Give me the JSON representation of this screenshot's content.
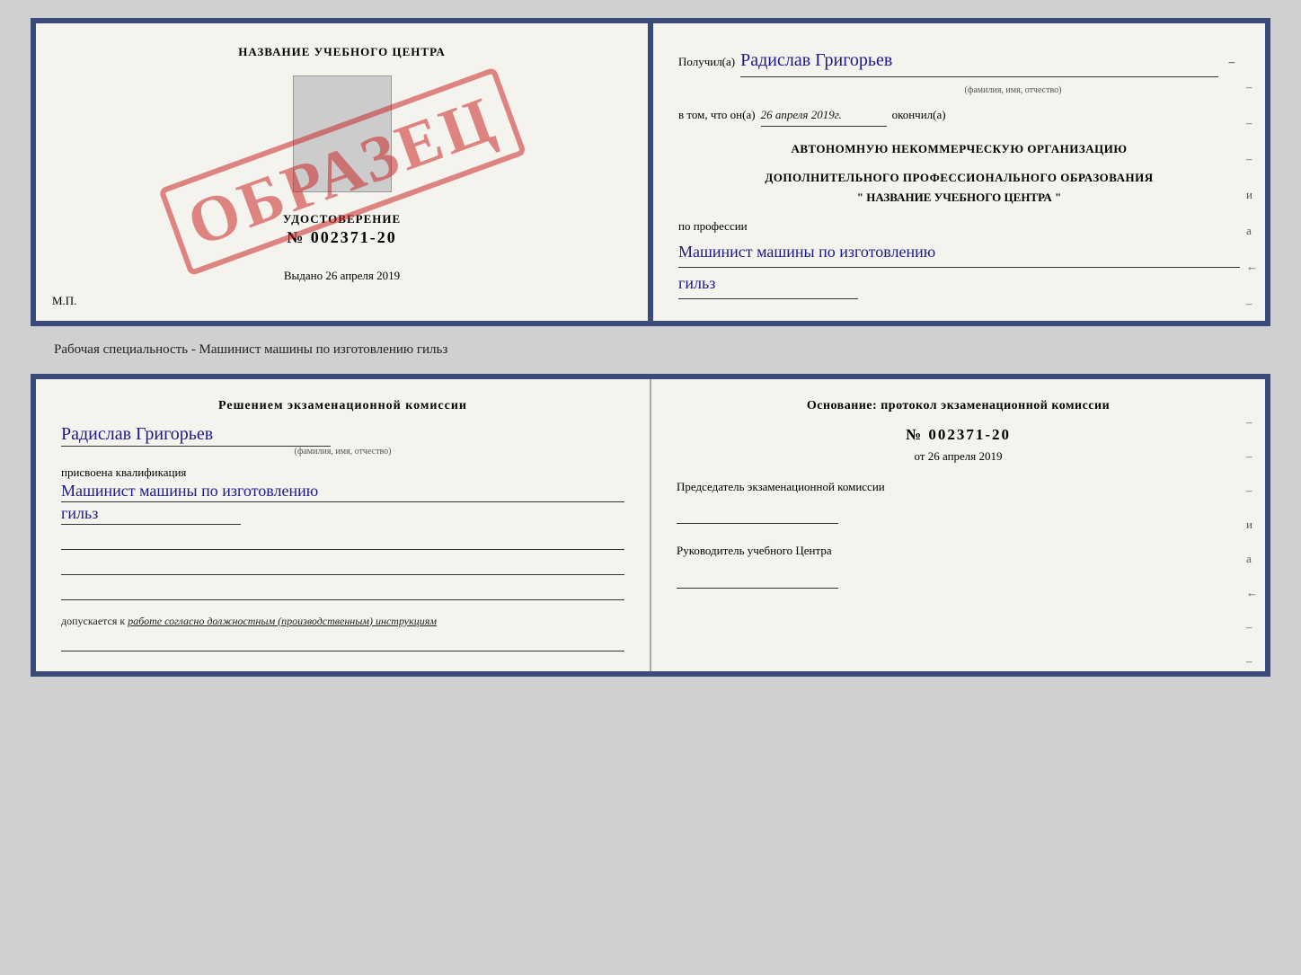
{
  "top_doc": {
    "left": {
      "center_title": "НАЗВАНИЕ УЧЕБНОГО ЦЕНТРА",
      "udostoverenie_title": "УДОСТОВЕРЕНИЕ",
      "udostoverenie_num": "№ 002371-20",
      "vydano_label": "Выдано",
      "vydano_date": "26 апреля 2019",
      "mp_label": "М.П.",
      "stamp_text": "ОБРАЗЕЦ"
    },
    "right": {
      "poluchil_label": "Получил(а)",
      "recipient_name": "Радислав Григорьев",
      "fio_hint": "(фамилия, имя, отчество)",
      "vtom_label": "в том, что он(а)",
      "completion_date": "26 апреля 2019г.",
      "okonchil_label": "окончил(а)",
      "org_line1": "АВТОНОМНУЮ НЕКОММЕРЧЕСКУЮ ОРГАНИЗАЦИЮ",
      "org_line2": "ДОПОЛНИТЕЛЬНОГО ПРОФЕССИОНАЛЬНОГО ОБРАЗОВАНИЯ",
      "org_name": "\"  НАЗВАНИЕ УЧЕБНОГО ЦЕНТРА  \"",
      "profession_label": "по профессии",
      "profession_text": "Машинист машины по изготовлению",
      "profession_text2": "гильз",
      "dashes": [
        "-",
        "-",
        "-",
        "и",
        "а",
        "←",
        "-"
      ]
    }
  },
  "doc_label": "Рабочая специальность - Машинист машины по изготовлению гильз",
  "bottom_doc": {
    "left": {
      "decision_title": "Решением  экзаменационной  комиссии",
      "name": "Радислав Григорьев",
      "fio_hint": "(фамилия, имя, отчество)",
      "prisvoena_label": "присвоена квалификация",
      "qualification_text": "Машинист машины по изготовлению",
      "qualification_text2": "гильз",
      "dopuskaetsya_label": "допускается к",
      "dopuskaetsya_text": "работе согласно должностным (производственным) инструкциям"
    },
    "right": {
      "osnovaniye_title": "Основание: протокол экзаменационной  комиссии",
      "protocol_num": "№  002371-20",
      "ot_label": "от",
      "ot_date": "26 апреля 2019",
      "predsedatel_label": "Председатель экзаменационной комиссии",
      "rukovoditel_label": "Руководитель учебного Центра",
      "dashes": [
        "-",
        "-",
        "-",
        "и",
        "а",
        "←",
        "-",
        "-",
        "-"
      ]
    }
  }
}
